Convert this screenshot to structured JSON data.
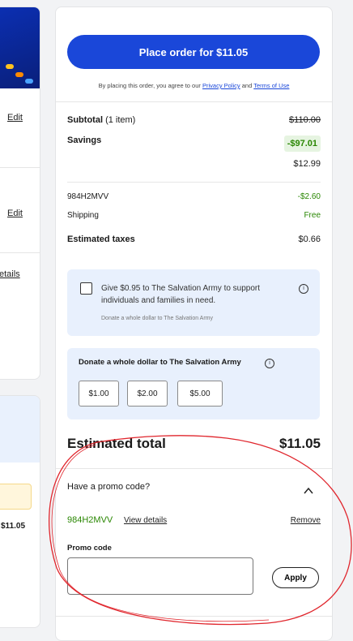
{
  "left_column": {
    "edit_1": "Edit",
    "edit_2": "Edit",
    "details_fragment": "etails",
    "price_fragment": "$11.05"
  },
  "order": {
    "place_button": "Place order for $11.05",
    "agree_prefix": "By placing this order, you agree to our",
    "privacy_link": "Privacy Policy",
    "and_text": "and",
    "terms_link": "Terms of Use"
  },
  "summary": {
    "subtotal_label": "Subtotal",
    "subtotal_items": "(1 item)",
    "subtotal_value": "$110.00",
    "savings_label": "Savings",
    "savings_value": "-$97.01",
    "after_savings": "$12.99",
    "promo_code_line": "984H2MVV",
    "promo_discount": "-$2.60",
    "shipping_label": "Shipping",
    "shipping_value": "Free",
    "taxes_label": "Estimated taxes",
    "taxes_value": "$0.66"
  },
  "charity": {
    "give_text": "Give $0.95 to The Salvation Army to support individuals and families in need.",
    "give_sub": "Donate a whole dollar to The Salvation Army",
    "donate_title": "Donate a whole dollar to The Salvation Army",
    "amounts": [
      "$1.00",
      "$2.00",
      "$5.00"
    ]
  },
  "total": {
    "label": "Estimated total",
    "value": "$11.05"
  },
  "promo": {
    "question": "Have a promo code?",
    "applied_code": "984H2MVV",
    "view_details": "View details",
    "remove": "Remove",
    "input_label": "Promo code",
    "input_value": "",
    "apply_button": "Apply"
  },
  "colors": {
    "primary_blue": "#1a47d9",
    "savings_green": "#2a8703",
    "info_bg": "#e8f0fd",
    "annotation_red": "#e0262d"
  }
}
